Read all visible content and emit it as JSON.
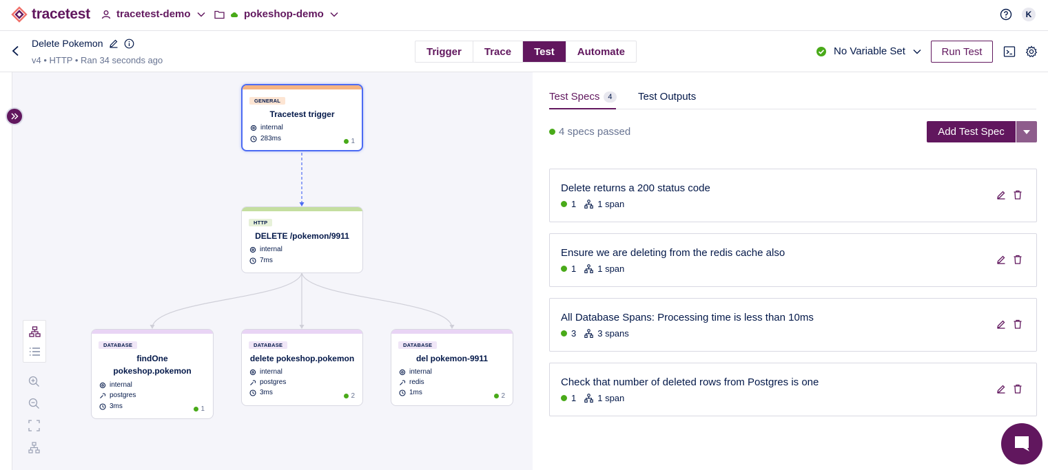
{
  "app": {
    "logo_text": "tracetest"
  },
  "topbar": {
    "environment": "tracetest-demo",
    "project": "pokeshop-demo",
    "avatar_initial": "K"
  },
  "test": {
    "name": "Delete Pokemon",
    "meta": "v4 • HTTP • Ran 34 seconds ago"
  },
  "tabs": [
    {
      "label": "Trigger",
      "active": false
    },
    {
      "label": "Trace",
      "active": false
    },
    {
      "label": "Test",
      "active": true
    },
    {
      "label": "Automate",
      "active": false
    }
  ],
  "variable_set": {
    "label": "No Variable Set"
  },
  "run_button": {
    "label": "Run Test"
  },
  "graph": {
    "nodes": [
      {
        "id": "trigger",
        "type_badge": "GENERAL",
        "name": "Tracetest trigger",
        "service": "internal",
        "duration": "283ms",
        "specs": "1"
      },
      {
        "id": "http",
        "type_badge": "HTTP",
        "name": "DELETE /pokemon/9911",
        "service": "internal",
        "duration": "7ms"
      },
      {
        "id": "findone",
        "type_badge": "DATABASE",
        "name_line1": "findOne",
        "name_line2": "pokeshop.pokemon",
        "service": "internal",
        "system": "postgres",
        "duration": "3ms",
        "specs": "1"
      },
      {
        "id": "delete",
        "type_badge": "DATABASE",
        "name": "delete pokeshop.pokemon",
        "service": "internal",
        "system": "postgres",
        "duration": "3ms",
        "specs": "2"
      },
      {
        "id": "del",
        "type_badge": "DATABASE",
        "name": "del pokemon-9911",
        "service": "internal",
        "system": "redis",
        "duration": "1ms",
        "specs": "2"
      }
    ],
    "colors": {
      "general": "#f5b482",
      "http": "#c4dea0",
      "database": "#e9d4f5",
      "selected_border": "#4c6bf3"
    }
  },
  "panel": {
    "tab_specs": "Test Specs",
    "tab_specs_count": "4",
    "tab_outputs": "Test Outputs",
    "passed_text": "4 specs passed",
    "add_spec_label": "Add Test Spec"
  },
  "specs": [
    {
      "title": "Delete returns a 200 status code",
      "passed": "1",
      "spans": "1 span"
    },
    {
      "title": "Ensure we are deleting from the redis cache also",
      "passed": "1",
      "spans": "1 span"
    },
    {
      "title": "All Database Spans: Processing time is less than 10ms",
      "passed": "3",
      "spans": "3 spans"
    },
    {
      "title": "Check that number of deleted rows from Postgres is one",
      "passed": "1",
      "spans": "1 span"
    }
  ],
  "theme": {
    "primary": "#61175e",
    "success": "#49aa19",
    "text": "#031849",
    "muted": "#687492"
  }
}
